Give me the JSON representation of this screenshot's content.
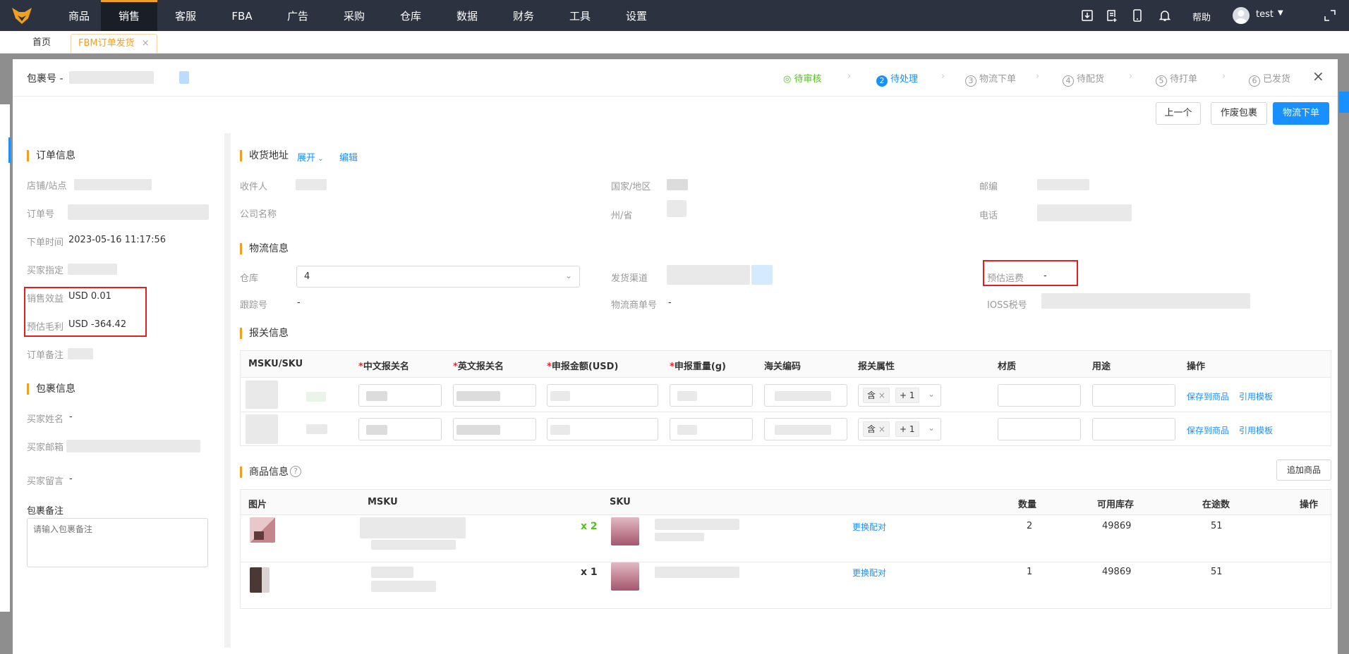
{
  "nav": {
    "items": [
      "商品",
      "销售",
      "客服",
      "FBA",
      "广告",
      "采购",
      "仓库",
      "数据",
      "财务",
      "工具",
      "设置"
    ],
    "active": "销售",
    "help": "帮助",
    "user": "test",
    "brand_color": "#f0a020"
  },
  "tabs": {
    "home": "首页",
    "current": "FBM订单发货",
    "close": "×"
  },
  "modal": {
    "title": "包裹号 -",
    "steps": [
      "待审核",
      "待处理",
      "物流下单",
      "待配货",
      "待打单",
      "已发货"
    ],
    "step_numbers": [
      "2",
      "3",
      "4",
      "5",
      "6"
    ],
    "close": "×",
    "buttons": {
      "prev": "上一个",
      "void": "作废包裹",
      "ship": "物流下单"
    }
  },
  "order": {
    "title": "订单信息",
    "labels": [
      "店铺/站点",
      "订单号",
      "下单时间",
      "买家指定",
      "销售效益",
      "预估毛利",
      "订单备注"
    ],
    "order_time": "2023-05-16 11:17:56",
    "sales_benefit": "USD 0.01",
    "est_profit": "USD -364.42"
  },
  "package": {
    "title": "包裹信息",
    "labels": [
      "买家姓名",
      "买家邮箱",
      "买家留言"
    ],
    "buyer_name": "-",
    "buyer_msg": "-",
    "note_label": "包裹备注",
    "note_placeholder": "请输入包裹备注"
  },
  "address": {
    "title": "收货地址",
    "expand": "展开",
    "edit": "编辑",
    "labels": [
      "收件人",
      "国家/地区",
      "邮编",
      "公司名称",
      "州/省",
      "电话"
    ]
  },
  "logistics": {
    "title": "物流信息",
    "warehouse_label": "仓库",
    "warehouse_value": "4",
    "channel_label": "发货渠道",
    "freight_label": "预估运费",
    "freight_value": "-",
    "tracking_label": "跟踪号",
    "tracking_value": "-",
    "logistics_no_label": "物流商单号",
    "logistics_no_value": "-",
    "ioss_label": "IOSS税号"
  },
  "customs": {
    "title": "报关信息",
    "headers": [
      "MSKU/SKU",
      "中文报关名",
      "英文报关名",
      "申报金额(USD)",
      "申报重量(g)",
      "海关编码",
      "报关属性",
      "材质",
      "用途",
      "操作"
    ],
    "tag_label": "含",
    "tag_more": "+ 1",
    "rows": [
      {
        "action1": "保存到商品",
        "action2": "引用模板"
      },
      {
        "action1": "保存到商品",
        "action2": "引用模板"
      }
    ]
  },
  "goods": {
    "title": "商品信息",
    "add_button": "追加商品",
    "headers": [
      "图片",
      "MSKU",
      "SKU",
      "数量",
      "可用库存",
      "在途数",
      "操作"
    ],
    "rows": [
      {
        "qty_badge": "x 2",
        "swap": "更换配对",
        "qty": "2",
        "stock": "49869",
        "transit": "51"
      },
      {
        "qty_badge": "x 1",
        "swap": "更换配对",
        "qty": "1",
        "stock": "49869",
        "transit": "51"
      }
    ]
  }
}
